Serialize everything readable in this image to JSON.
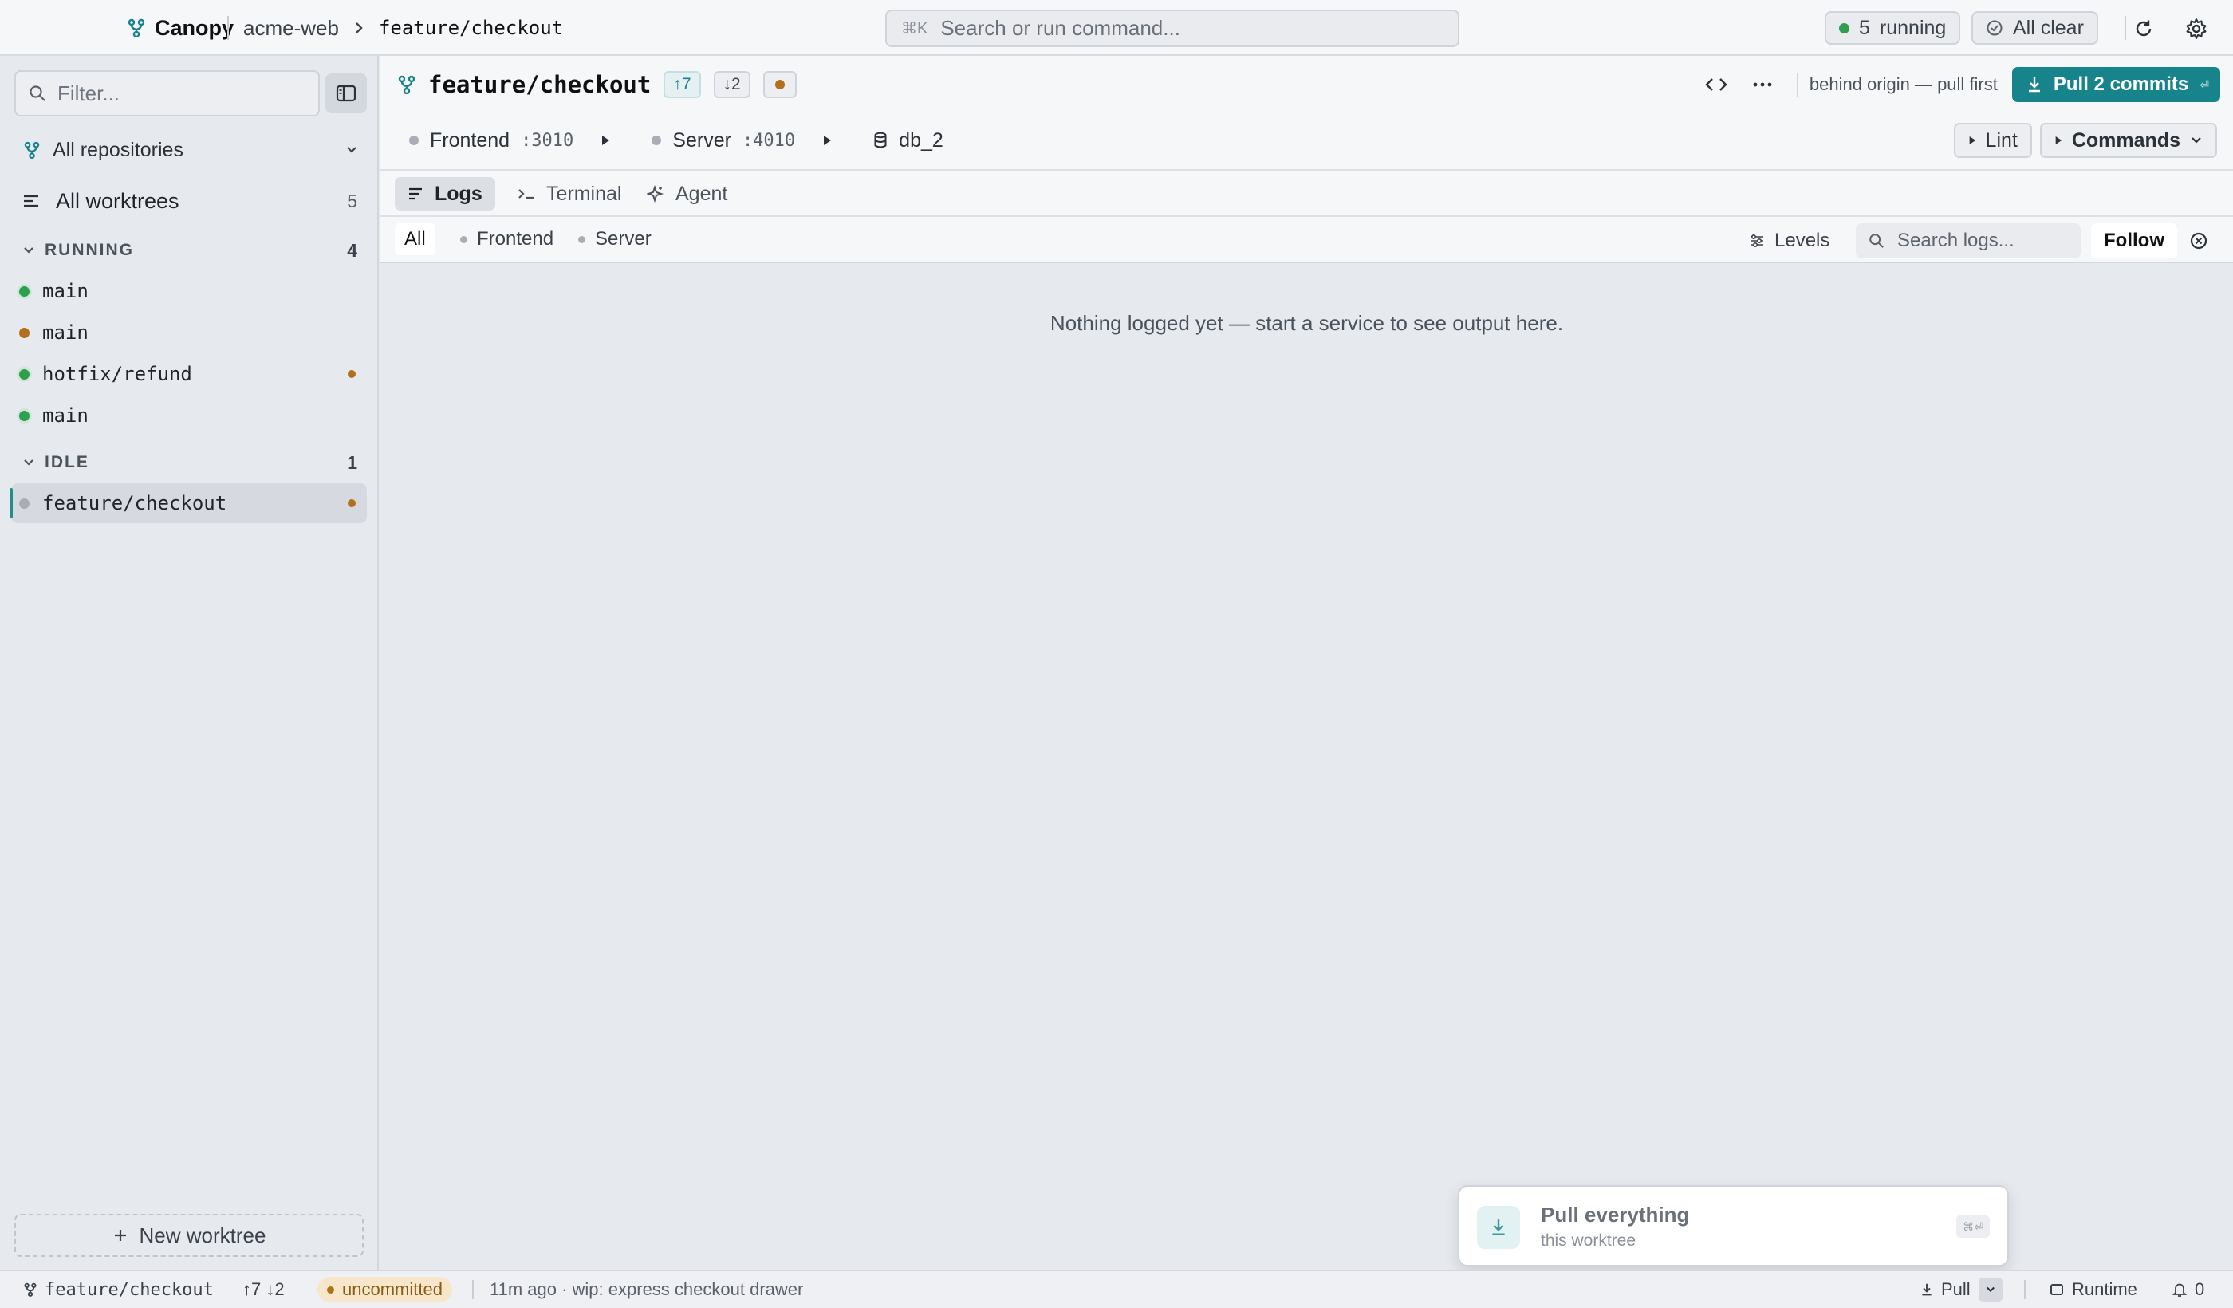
{
  "topbar": {
    "app_name": "Canopy",
    "repo": "acme-web",
    "branch": "feature/checkout",
    "command_shortcut": "⌘K",
    "command_placeholder": "Search or run command...",
    "running_count": "5",
    "running_label": "running",
    "status_label": "All clear"
  },
  "sidebar": {
    "filter_placeholder": "Filter...",
    "repo_selector": "All repositories",
    "all_worktrees_label": "All worktrees",
    "all_worktrees_count": "5",
    "groups": [
      {
        "label": "RUNNING",
        "count": "4",
        "items": [
          {
            "name": "main",
            "status": "running"
          },
          {
            "name": "main",
            "status": "starting"
          },
          {
            "name": "hotfix/refund",
            "status": "running",
            "dirty": true
          },
          {
            "name": "main",
            "status": "running"
          }
        ]
      },
      {
        "label": "IDLE",
        "count": "1",
        "items": [
          {
            "name": "feature/checkout",
            "status": "idle",
            "dirty": true,
            "selected": true
          }
        ]
      }
    ],
    "new_worktree_label": "New worktree"
  },
  "worktree": {
    "branch": "feature/checkout",
    "ahead": "↑7",
    "behind": "↓2",
    "sync_note": "behind origin — pull first",
    "pull_button": "Pull 2 commits",
    "pull_shortcut": "⏎",
    "services": [
      {
        "name": "Frontend",
        "port": ":3010",
        "status": "stopped"
      },
      {
        "name": "Server",
        "port": ":4010",
        "status": "stopped"
      }
    ],
    "database": "db_2",
    "lint_label": "Lint",
    "commands_label": "Commands"
  },
  "tabs": [
    {
      "label": "Logs",
      "active": true
    },
    {
      "label": "Terminal",
      "active": false
    },
    {
      "label": "Agent",
      "active": false
    }
  ],
  "log_filters": {
    "sources": [
      {
        "label": "All",
        "active": true
      },
      {
        "label": "Frontend",
        "active": false
      },
      {
        "label": "Server",
        "active": false
      }
    ],
    "levels_label": "Levels",
    "search_placeholder": "Search logs...",
    "follow_label": "Follow"
  },
  "empty_message": "Nothing logged yet — start a service to see output here.",
  "toast": {
    "title": "Pull everything",
    "subtitle": "this worktree",
    "shortcut": "⌘⏎"
  },
  "statusbar": {
    "branch": "feature/checkout",
    "ahead_behind": "↑7 ↓2",
    "uncommitted": "uncommitted",
    "last_commit": "11m ago · wip: express checkout drawer",
    "pull_label": "Pull",
    "runtime_label": "Runtime",
    "notifications_count": "0"
  },
  "colors": {
    "accent": "#17838a",
    "running": "#2e9e4f",
    "warning": "#b2701c",
    "idle": "#a9aeb6"
  }
}
